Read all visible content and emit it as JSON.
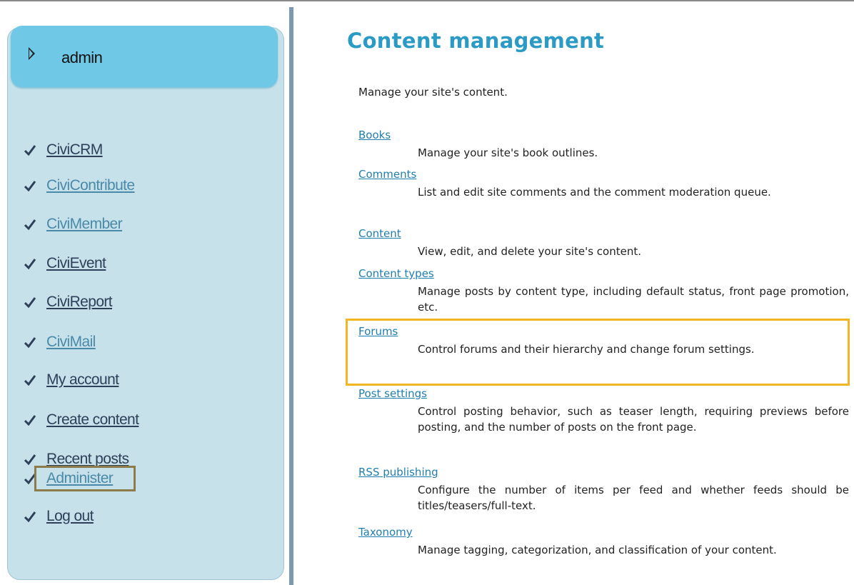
{
  "sidebar": {
    "username": "admin",
    "items": [
      {
        "label": "CiviCRM",
        "style": "dark"
      },
      {
        "label": "CiviContribute",
        "style": "light"
      },
      {
        "label": "CiviMember",
        "style": "light"
      },
      {
        "label": "CiviEvent",
        "style": "dark"
      },
      {
        "label": "CiviReport",
        "style": "dark"
      },
      {
        "label": "CiviMail",
        "style": "light"
      },
      {
        "label": "My account",
        "style": "dark"
      },
      {
        "label": "Create content",
        "style": "dark"
      },
      {
        "label": "Recent posts",
        "style": "dark"
      },
      {
        "label": "Administer",
        "style": "light"
      },
      {
        "label": "Log out",
        "style": "dark"
      }
    ]
  },
  "main": {
    "title": "Content management",
    "intro": "Manage your site's content.",
    "entries": [
      {
        "link": "Books",
        "description": "Manage your site's book outlines."
      },
      {
        "link": "Comments",
        "description": "List and edit site comments and the comment moderation queue."
      },
      {
        "link": "Content",
        "description": "View, edit, and delete your site's content."
      },
      {
        "link": "Content types",
        "description": "Manage posts by content type, including default status, front page promotion, etc."
      },
      {
        "link": "Forums",
        "description": "Control forums and their hierarchy and change forum settings."
      },
      {
        "link": "Post settings",
        "description": "Control posting behavior, such as teaser length, requiring previews before posting, and the number of posts on the front page."
      },
      {
        "link": "RSS publishing",
        "description": "Configure the number of items per feed and whether feeds should be titles/teasers/full-text."
      },
      {
        "link": "Taxonomy",
        "description": "Manage tagging, categorization, and classification of your content."
      }
    ]
  },
  "colors": {
    "title": "#2b9bc5",
    "link": "#1f7fae",
    "sidebar_bg": "#c6e1ea",
    "header_bg": "#6ec8e6",
    "highlight_forums": "#f3b623",
    "highlight_administer": "#8b7c4a"
  },
  "icons": {
    "header": "triangle-right-icon",
    "menu": "checkmark-icon"
  }
}
